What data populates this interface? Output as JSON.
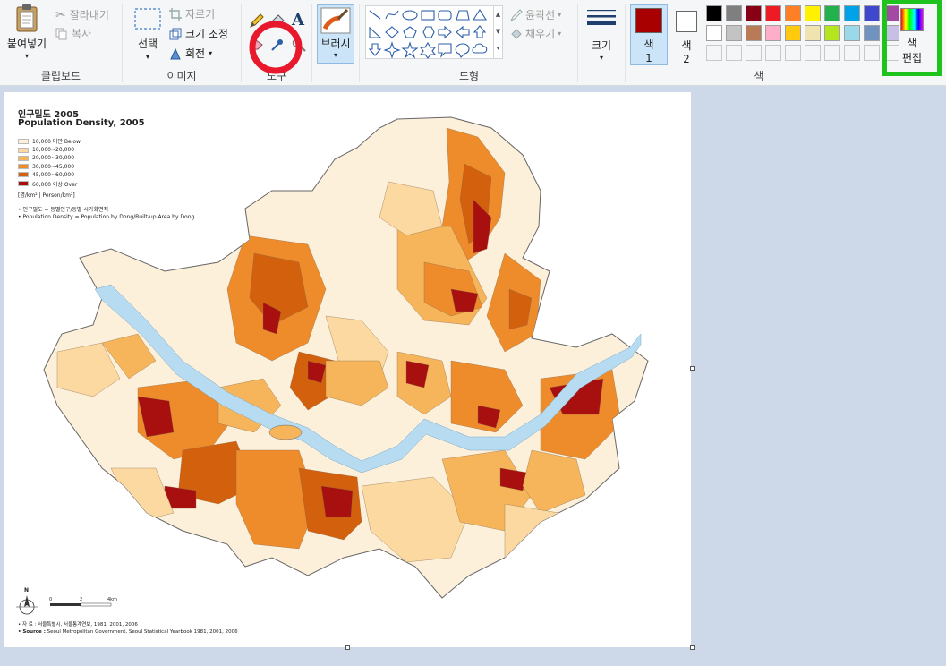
{
  "ribbon": {
    "clipboard": {
      "paste_label": "붙여넣기",
      "cut_label": "잘라내기",
      "copy_label": "복사",
      "group_label": "클립보드"
    },
    "image": {
      "select_label": "선택",
      "crop_label": "자르기",
      "resize_label": "크기 조정",
      "rotate_label": "회전",
      "group_label": "이미지"
    },
    "tools": {
      "group_label": "도구"
    },
    "brush": {
      "label": "브러시"
    },
    "shapes": {
      "outline_label": "윤곽선",
      "fill_label": "채우기",
      "group_label": "도형"
    },
    "size": {
      "label": "크기"
    },
    "colors": {
      "color1_label": "색",
      "color1_num": "1",
      "color2_label": "색",
      "color2_num": "2",
      "edit_label_1": "색",
      "edit_label_2": "편집",
      "group_label": "색",
      "color1_value": "#a80000",
      "color2_value": "#ffffff",
      "palette_row1": [
        "#000000",
        "#7f7f7f",
        "#880015",
        "#ed1c24",
        "#ff7f27",
        "#fff200",
        "#22b14c",
        "#00a2e8",
        "#3f48cc",
        "#a349a4"
      ],
      "palette_row2": [
        "#ffffff",
        "#c3c3c3",
        "#b97a57",
        "#ffaec9",
        "#ffc90e",
        "#efe4b0",
        "#b5e61d",
        "#99d9ea",
        "#7092be",
        "#c8bfe7"
      ]
    }
  },
  "annotations": {
    "red_circle_color": "#e8192c",
    "green_box_color": "#1ec31e"
  },
  "map": {
    "title_ko": "인구밀도 2005",
    "title_en": "Population Density, 2005",
    "legend": [
      {
        "label": "10,000 미만  Below",
        "color": "#fdf0da"
      },
      {
        "label": "10,000~20,000",
        "color": "#fbd9a0"
      },
      {
        "label": "20,000~30,000",
        "color": "#f6b55a"
      },
      {
        "label": "30,000~45,000",
        "color": "#ee8c2c"
      },
      {
        "label": "45,000~60,000",
        "color": "#d2600d"
      },
      {
        "label": "60,000 이상  Over",
        "color": "#a80f0f"
      }
    ],
    "unit": "[명/km²  |  Person/km²]",
    "note1": "• 인구밀도 = 동별인구/동별 시가화면적",
    "note2": "• Population Density = Population by Dong/Built-up Area by Dong",
    "north": "N",
    "scale_0": "0",
    "scale_2": "2",
    "scale_4": "4km",
    "source_ko": "• 자    료 : 서울특별시, 서울통계연보, 1981, 2001, 2006",
    "source_en_label": "• Source :",
    "source_en": " Seoul Metropolitan Government, Seoul Statistical Yearbook 1981, 2001, 2006",
    "river_color": "#b7dcf2"
  }
}
